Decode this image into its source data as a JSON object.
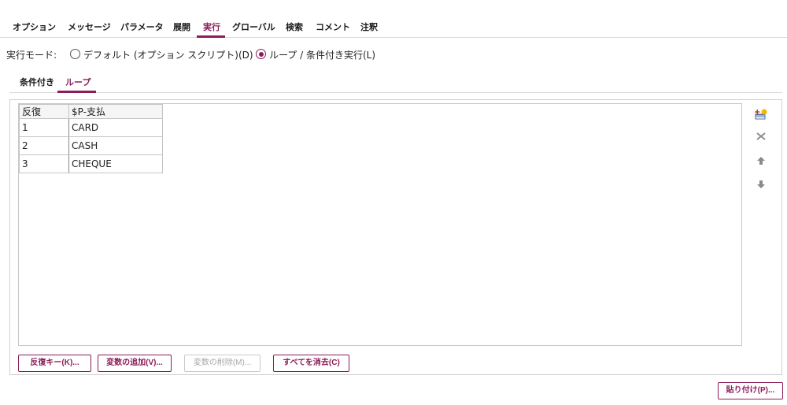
{
  "top_tabs": [
    "オプション",
    "メッセージ",
    "パラメータ",
    "展開",
    "実行",
    "グローバル",
    "検索",
    "コメント",
    "注釈"
  ],
  "active_top_tab": "実行",
  "run_mode": {
    "label": "実行モード:",
    "options": [
      "デフォルト (オプション スクリプト)(D)",
      "ループ / 条件付き実行(L)"
    ],
    "selected": "ループ / 条件付き実行(L)"
  },
  "sub_tabs": [
    "条件付き",
    "ループ"
  ],
  "active_sub_tab": "ループ",
  "table": {
    "columns": [
      "反復",
      "$P-支払"
    ],
    "rows": [
      [
        "1",
        "CARD"
      ],
      [
        "2",
        "CASH"
      ],
      [
        "3",
        "CHEQUE"
      ]
    ]
  },
  "side_icons": [
    "add-icon",
    "delete-icon",
    "arrow-up-icon",
    "arrow-down-icon"
  ],
  "buttons": {
    "iteration_key": "反復キー(K)...",
    "add_variable": "変数の追加(V)...",
    "delete_variable": "変数の削除(M)...",
    "clear_all": "すべてを消去(C)",
    "paste": "貼り付け(P)..."
  },
  "colors": {
    "accent": "#8c1d5a",
    "border": "#d0d0d0"
  }
}
